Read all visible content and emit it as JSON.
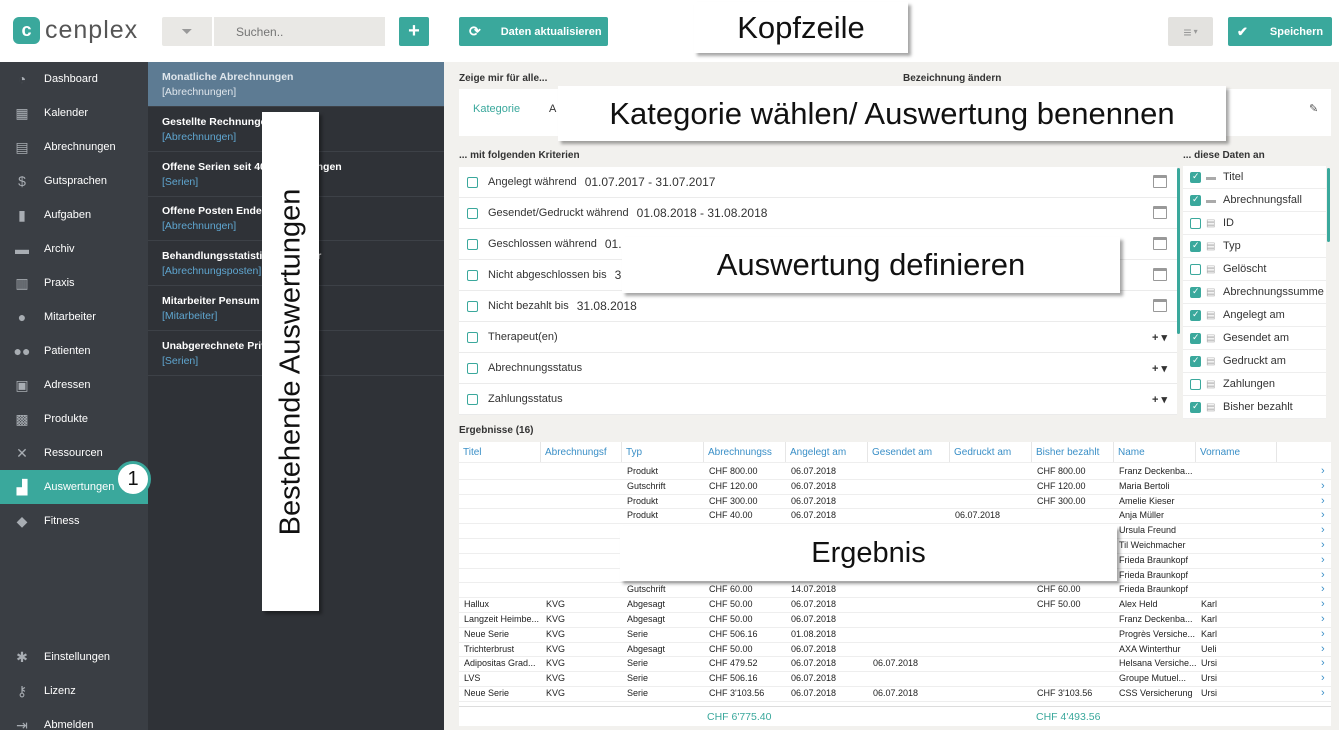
{
  "header": {
    "logo_letter": "c",
    "logo_text": "cenplex",
    "filter_icon": "filter-icon",
    "search_placeholder": "Suchen..",
    "add_label": "+",
    "refresh_label": "Daten aktualisieren",
    "menu_icon": "≡",
    "save_label": "Speichern",
    "accent": "#3aa89c"
  },
  "nav": [
    {
      "label": "Dashboard",
      "icon": "◔"
    },
    {
      "label": "Kalender",
      "icon": "▦"
    },
    {
      "label": "Abrechnungen",
      "icon": "▤"
    },
    {
      "label": "Gutsprachen",
      "icon": "$"
    },
    {
      "label": "Aufgaben",
      "icon": "▮"
    },
    {
      "label": "Archiv",
      "icon": "▬"
    },
    {
      "label": "Praxis",
      "icon": "▥"
    },
    {
      "label": "Mitarbeiter",
      "icon": "●"
    },
    {
      "label": "Patienten",
      "icon": "●●"
    },
    {
      "label": "Adressen",
      "icon": "▣"
    },
    {
      "label": "Produkte",
      "icon": "▩"
    },
    {
      "label": "Ressourcen",
      "icon": "✕"
    },
    {
      "label": "Auswertungen",
      "icon": "▟"
    },
    {
      "label": "Fitness",
      "icon": "◆"
    }
  ],
  "nav_bottom": [
    {
      "label": "Einstellungen",
      "icon": "✱"
    },
    {
      "label": "Lizenz",
      "icon": "⚷"
    },
    {
      "label": "Abmelden",
      "icon": "⇥"
    }
  ],
  "evaluations": [
    {
      "title": "Monatliche Abrechnungen",
      "sub": "[Abrechnungen]"
    },
    {
      "title": "Gestellte Rechnungen",
      "sub": "[Abrechnungen]"
    },
    {
      "title": "Offene Serien seit 40 Behandlungen",
      "sub": "[Serien]"
    },
    {
      "title": "Offene Posten Ende M",
      "sub": "[Abrechnungen]"
    },
    {
      "title": "Behandlungsstatistik ut im Jahr",
      "sub": "[Abrechnungsposten]"
    },
    {
      "title": "Mitarbeiter Pensum p",
      "sub": "[Mitarbeiter]"
    },
    {
      "title": "Unabgerechnete Priva gen",
      "sub": "[Serien]"
    }
  ],
  "show_all": {
    "label": "Zeige mir für alle...",
    "category_label": "Kategorie",
    "category_value": "A",
    "rename_label": "Bezeichnung ändern",
    "edit_icon": "✎"
  },
  "criteria": {
    "label": "... mit folgenden Kriterien",
    "rows": [
      {
        "label": "Angelegt während",
        "value": "01.07.2017 - 31.07.2017",
        "action": "calendar"
      },
      {
        "label": "Gesendet/Gedruckt während",
        "value": "01.08.2018 - 31.08.2018",
        "action": "calendar"
      },
      {
        "label": "Geschlossen während",
        "value": "01.08.",
        "action": "calendar"
      },
      {
        "label": "Nicht abgeschlossen bis",
        "value": "31.0",
        "action": "calendar"
      },
      {
        "label": "Nicht bezahlt bis",
        "value": "31.08.2018",
        "action": "calendar"
      },
      {
        "label": "Therapeut(en)",
        "value": "",
        "action": "plus"
      },
      {
        "label": "Abrechnungsstatus",
        "value": "",
        "action": "plus"
      },
      {
        "label": "Zahlungsstatus",
        "value": "",
        "action": "plus"
      }
    ]
  },
  "data_fields": {
    "label": "... diese Daten an",
    "rows": [
      {
        "label": "Titel",
        "checked": true,
        "icon": "▬"
      },
      {
        "label": "Abrechnungsfall",
        "checked": true,
        "icon": "▬"
      },
      {
        "label": "ID",
        "checked": false,
        "icon": "▤"
      },
      {
        "label": "Typ",
        "checked": true,
        "icon": "▤"
      },
      {
        "label": "Gelöscht",
        "checked": false,
        "icon": "▤"
      },
      {
        "label": "Abrechnungssumme",
        "checked": true,
        "icon": "▤"
      },
      {
        "label": "Angelegt am",
        "checked": true,
        "icon": "▤"
      },
      {
        "label": "Gesendet am",
        "checked": true,
        "icon": "▤"
      },
      {
        "label": "Gedruckt am",
        "checked": true,
        "icon": "▤"
      },
      {
        "label": "Zahlungen",
        "checked": false,
        "icon": "▤"
      },
      {
        "label": "Bisher bezahlt",
        "checked": true,
        "icon": "▤"
      }
    ]
  },
  "results": {
    "label": "Ergebnisse (16)",
    "columns": [
      "Titel",
      "Abrechnungsf",
      "Typ",
      "Abrechnungss",
      "Angelegt am",
      "Gesendet am",
      "Gedruckt am",
      "Bisher bezahlt",
      "Name",
      "Vorname"
    ],
    "rows": [
      [
        "",
        "",
        "Produkt",
        "CHF 800.00",
        "06.07.2018",
        "",
        "",
        "CHF 800.00",
        "Franz Deckenba...",
        ""
      ],
      [
        "",
        "",
        "Gutschrift",
        "CHF 120.00",
        "06.07.2018",
        "",
        "",
        "CHF 120.00",
        "Maria Bertoli",
        ""
      ],
      [
        "",
        "",
        "Produkt",
        "CHF 300.00",
        "06.07.2018",
        "",
        "",
        "CHF 300.00",
        "Amelie Kieser",
        ""
      ],
      [
        "",
        "",
        "Produkt",
        "CHF 40.00",
        "06.07.2018",
        "",
        "06.07.2018",
        "",
        "Anja Müller",
        ""
      ],
      [
        "",
        "",
        "",
        "",
        "",
        "",
        "",
        "",
        "Ursula Freund",
        ""
      ],
      [
        "",
        "",
        "",
        "",
        "",
        "",
        "",
        "",
        "Til Weichmacher",
        ""
      ],
      [
        "",
        "",
        "",
        "",
        "",
        "",
        "",
        "",
        "Frieda Braunkopf",
        ""
      ],
      [
        "",
        "",
        "",
        "",
        "",
        "",
        "",
        "",
        "Frieda Braunkopf",
        ""
      ],
      [
        "",
        "",
        "Gutschrift",
        "CHF 60.00",
        "14.07.2018",
        "",
        "",
        "CHF 60.00",
        "Frieda Braunkopf",
        ""
      ],
      [
        "Hallux",
        "KVG",
        "Abgesagt",
        "CHF 50.00",
        "06.07.2018",
        "",
        "",
        "CHF 50.00",
        "Alex Held",
        "Karl"
      ],
      [
        "Langzeit Heimbe...",
        "KVG",
        "Abgesagt",
        "CHF 50.00",
        "06.07.2018",
        "",
        "",
        "",
        "Franz Deckenba...",
        "Karl"
      ],
      [
        "Neue Serie",
        "KVG",
        "Serie",
        "CHF 506.16",
        "01.08.2018",
        "",
        "",
        "",
        "Progrès Versiche...",
        "Karl"
      ],
      [
        "Trichterbrust",
        "KVG",
        "Abgesagt",
        "CHF 50.00",
        "06.07.2018",
        "",
        "",
        "",
        "AXA Winterthur",
        "Ueli"
      ],
      [
        "Adipositas Grad...",
        "KVG",
        "Serie",
        "CHF 479.52",
        "06.07.2018",
        "06.07.2018",
        "",
        "",
        "Helsana Versiche...",
        "Ursi"
      ],
      [
        "LVS",
        "KVG",
        "Serie",
        "CHF 506.16",
        "06.07.2018",
        "",
        "",
        "",
        "Groupe Mutuel...",
        "Ursi"
      ],
      [
        "Neue Serie",
        "KVG",
        "Serie",
        "CHF 3'103.56",
        "06.07.2018",
        "06.07.2018",
        "",
        "CHF 3'103.56",
        "CSS Versicherung",
        "Ursi"
      ]
    ],
    "total_sum": "CHF 6'775.40",
    "total_paid": "CHF 4'493.56"
  },
  "annotations": {
    "kopfzeile": "Kopfzeile",
    "kategorie": "Kategorie wählen/ Auswertung benennen",
    "bestehende": "Bestehende Auswertungen",
    "definieren": "Auswertung definieren",
    "ergebnis": "Ergebnis",
    "badge": "1"
  }
}
